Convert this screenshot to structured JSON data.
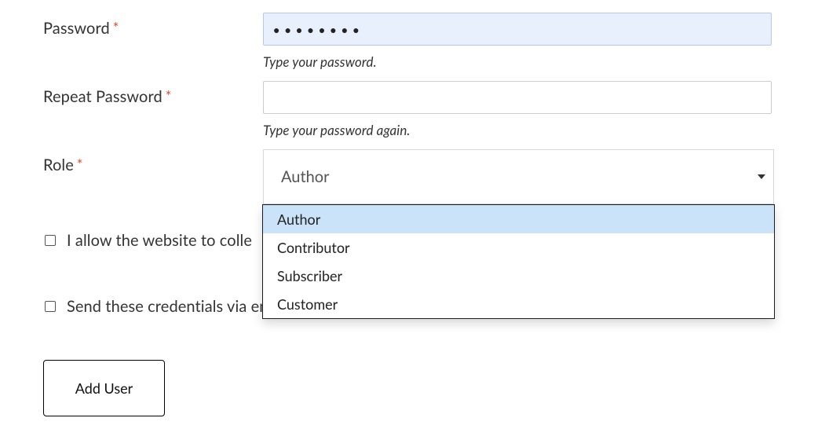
{
  "fields": {
    "password": {
      "label": "Password",
      "hint": "Type your password.",
      "masked_value": "●●●●●●●●"
    },
    "repeat_password": {
      "label": "Repeat Password",
      "hint": "Type your password again.",
      "value": ""
    },
    "role": {
      "label": "Role",
      "selected": "Author",
      "options": [
        "Author",
        "Contributor",
        "Subscriber",
        "Customer"
      ]
    }
  },
  "checkboxes": {
    "consent": "I allow the website to colle",
    "send_email": "Send these credentials via email."
  },
  "submit": "Add User"
}
